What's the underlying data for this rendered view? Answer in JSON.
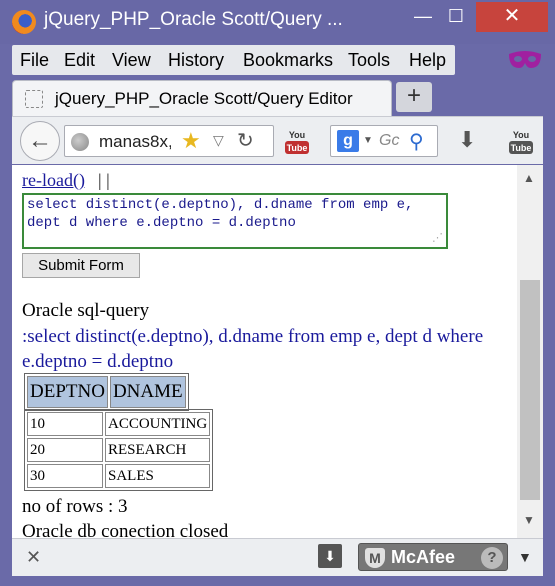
{
  "window": {
    "title": "jQuery_PHP_Oracle Scott/Query ...",
    "minimize": "—",
    "maximize": "☐",
    "close": "✕"
  },
  "menu": {
    "items": [
      "File",
      "Edit",
      "View",
      "History",
      "Bookmarks",
      "Tools",
      "Help"
    ]
  },
  "tab": {
    "title": "jQuery_PHP_Oracle Scott/Query Editor",
    "new_tab": "+"
  },
  "toolbar": {
    "back": "←",
    "url": "manas8x,",
    "search_engine_letter": "g",
    "search_placeholder": "Gc",
    "youtube_label": "You Tube"
  },
  "content": {
    "reload_link": "re-load()",
    "reload_separator": "| |",
    "query_text": "select distinct(e.deptno), d.dname from emp e, dept d where e.deptno = d.deptno",
    "submit_label": "Submit Form",
    "oracle_label": "Oracle sql-query",
    "query_echo": ":select distinct(e.deptno), d.dname from emp e, dept d where e.deptno = d.deptno",
    "table_headers": [
      "DEPTNO",
      "DNAME"
    ],
    "table_rows": [
      [
        "10",
        "ACCOUNTING"
      ],
      [
        "20",
        "RESEARCH"
      ],
      [
        "30",
        "SALES"
      ]
    ],
    "rows_text": "no of rows : 3",
    "closed_text": "Oracle db conection closed"
  },
  "statusbar": {
    "close": "✕",
    "mcafee_label": "McAfee",
    "help": "?"
  },
  "colors": {
    "titlebar": "#6868a6",
    "link": "#1a1a9c",
    "query_border": "#3a8a3a",
    "header_cell": "#b0c4de",
    "close_button": "#c7443d"
  }
}
